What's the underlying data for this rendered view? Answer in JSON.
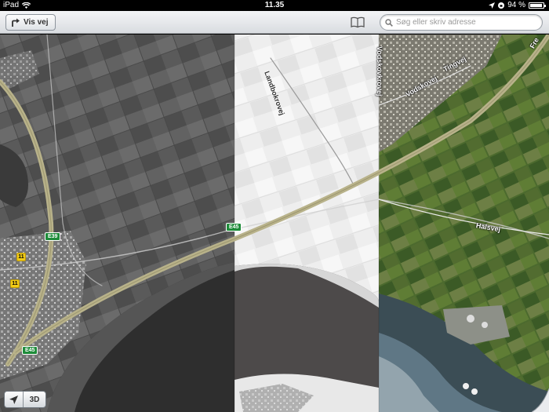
{
  "status_bar": {
    "device": "iPad",
    "time": "11.35",
    "battery": "94 %"
  },
  "toolbar": {
    "directions_label": "Vis vej",
    "bookmarks_icon": "book-icon",
    "search_placeholder": "Søg eller skriv adresse"
  },
  "map": {
    "street_labels": [
      "Landbokrovej",
      "Vodskovkrovej",
      "Vodskovej",
      "Tingvej",
      "Halsvej",
      "Fre"
    ],
    "route_shields": [
      {
        "label": "E39",
        "type": "european"
      },
      {
        "label": "E45",
        "type": "european"
      },
      {
        "label": "E45",
        "type": "european"
      },
      {
        "label": "11",
        "type": "regional"
      },
      {
        "label": "11",
        "type": "regional"
      }
    ]
  },
  "controls": {
    "location_icon": "location-arrow-icon",
    "mode_3d_label": "3D",
    "page_curl_icon": "page-curl-icon"
  },
  "colors": {
    "highway": "#b8b28a",
    "shield_green": "#1e8c3a",
    "shield_yellow": "#f2cc16"
  }
}
